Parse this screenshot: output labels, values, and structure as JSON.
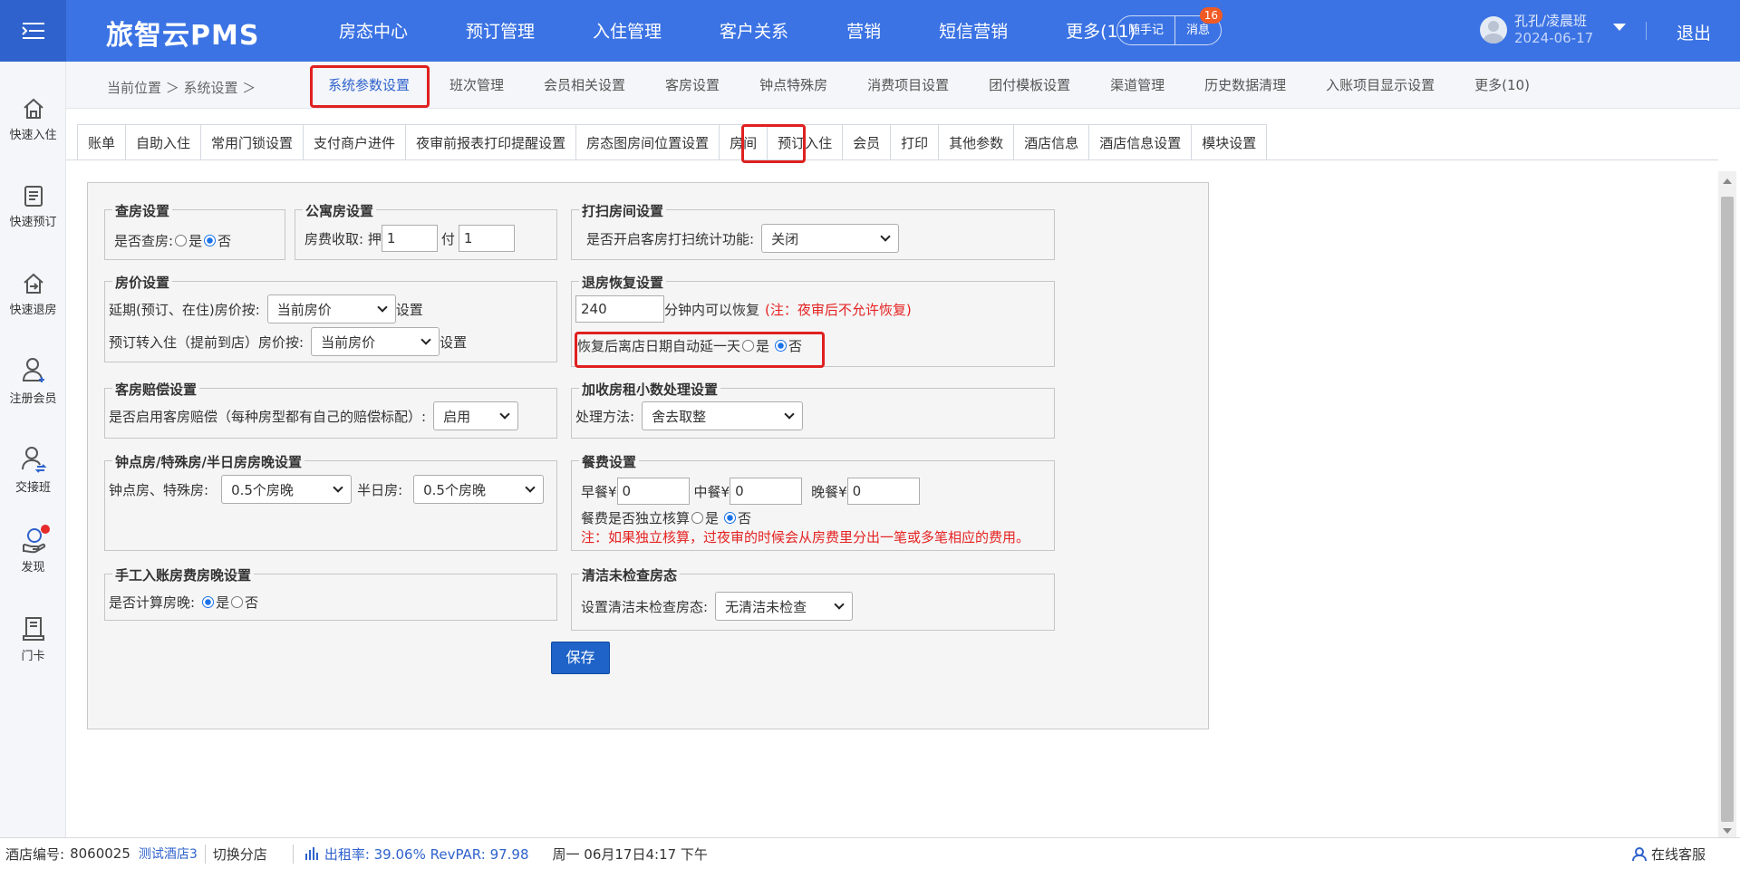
{
  "app": {
    "logo": "旅智云PMS"
  },
  "topnav": [
    "房态中心",
    "预订管理",
    "入住管理",
    "客户关系",
    "营销",
    "短信营销",
    "更多(11)"
  ],
  "header": {
    "memo": "随手记",
    "message": "消息",
    "message_count": "16",
    "user_name": "孔孔/凌晨班",
    "user_date": "2024-06-17",
    "logout": "退出"
  },
  "sidebar": [
    {
      "label": "快速入住",
      "icon": "home-icon"
    },
    {
      "label": "快速预订",
      "icon": "booking-list-icon"
    },
    {
      "label": "快速退房",
      "icon": "checkout-icon"
    },
    {
      "label": "注册会员",
      "icon": "add-member-icon"
    },
    {
      "label": "交接班",
      "icon": "handover-icon"
    },
    {
      "label": "发现",
      "icon": "discover-icon"
    },
    {
      "label": "门卡",
      "icon": "door-card-icon"
    }
  ],
  "breadcrumb": {
    "location": "当前位置 ＞ 系统设置 ＞"
  },
  "settings_tabs": [
    "系统参数设置",
    "班次管理",
    "会员相关设置",
    "客房设置",
    "钟点特殊房",
    "消费项目设置",
    "团付模板设置",
    "渠道管理",
    "历史数据清理",
    "入账项目显示设置",
    "更多(10)"
  ],
  "sub_tabs": [
    "账单",
    "自助入住",
    "常用门锁设置",
    "支付商户进件",
    "夜审前报表打印提醒设置",
    "房态图房间位置设置",
    "房间",
    "预订入住",
    "会员",
    "打印",
    "其他参数",
    "酒店信息",
    "酒店信息设置",
    "模块设置"
  ],
  "sections": {
    "check_room": {
      "title": "查房设置",
      "label": "是否查房:",
      "opt_yes": "是",
      "opt_no": "否",
      "selected": "否"
    },
    "apartment": {
      "title": "公寓房设置",
      "label": "房费收取: 押",
      "deposit": "1",
      "pay_label": "付",
      "pay": "1"
    },
    "cleaning": {
      "title": "打扫房间设置",
      "label": "是否开启客房打扫统计功能:",
      "value": "关闭"
    },
    "room_price": {
      "title": "房价设置",
      "row1_label": "延期(预订、在住)房价按:",
      "row1_value": "当前房价",
      "row1_suffix": "设置",
      "row2_label": "预订转入住（提前到店）房价按:",
      "row2_value": "当前房价",
      "row2_suffix": "设置"
    },
    "checkout_restore": {
      "title": "退房恢复设置",
      "minutes": "240",
      "suffix": "分钟内可以恢复",
      "note": "(注：夜审后不允许恢复)",
      "extend_label": "恢复后离店日期自动延一天",
      "opt_yes": "是",
      "opt_no": "否",
      "selected": "否"
    },
    "compensation": {
      "title": "客房赔偿设置",
      "label": "是否启用客房赔偿（每种房型都有自己的赔偿标配）:",
      "value": "启用"
    },
    "decimal": {
      "title": "加收房租小数处理设置",
      "label": "处理方法:",
      "value": "舍去取整"
    },
    "hourly": {
      "title": "钟点房/特殊房/半日房房晚设置",
      "label1": "钟点房、特殊房:",
      "value1": "0.5个房晚",
      "label2": "半日房:",
      "value2": "0.5个房晚"
    },
    "meal": {
      "title": "餐费设置",
      "breakfast_label": "早餐¥",
      "breakfast": "0",
      "lunch_label": "中餐¥",
      "lunch": "0",
      "dinner_label": "晚餐¥",
      "dinner": "0",
      "independent_label": "餐费是否独立核算",
      "opt_yes": "是",
      "opt_no": "否",
      "selected": "否",
      "note": "注：如果独立核算，过夜审的时候会从房费里分出一笔或多笔相应的费用。"
    },
    "manual": {
      "title": "手工入账房费房晚设置",
      "label": "是否计算房晚:",
      "opt_yes": "是",
      "opt_no": "否",
      "selected": "是"
    },
    "clean_status": {
      "title": "清洁未检查房态",
      "label": "设置清洁未检查房态:",
      "value": "无清洁未检查"
    }
  },
  "save_label": "保存",
  "status_bar": {
    "hotel_id_label": "酒店编号:",
    "hotel_id": "8060025",
    "hotel_name": "测试酒店3",
    "switch": "切换分店",
    "occupancy": "出租率: 39.06% RevPAR: 97.98",
    "datetime": "周一 06月17日4:17 下午",
    "service": "在线客服"
  }
}
